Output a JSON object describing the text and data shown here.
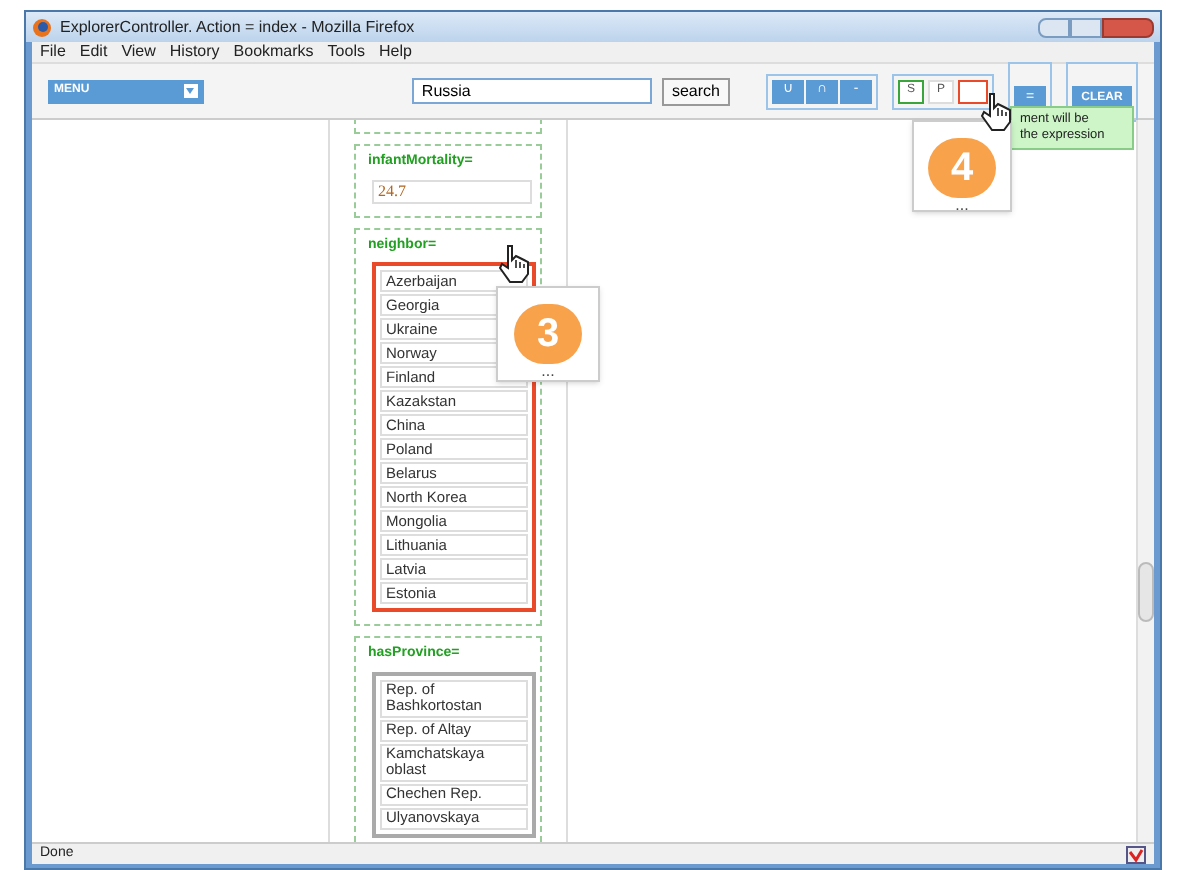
{
  "window": {
    "title": "ExplorerController. Action = index - Mozilla Firefox"
  },
  "menu_bar": [
    "File",
    "Edit",
    "View",
    "History",
    "Bookmarks",
    "Tools",
    "Help"
  ],
  "toolbar": {
    "menu_button": "MENU",
    "search_value": "Russia",
    "search_button": "search",
    "set_ops": [
      "∪",
      "∩",
      "-"
    ],
    "mode_buttons": [
      {
        "label": "S",
        "selected": true
      },
      {
        "label": "P",
        "selected": false
      }
    ],
    "drop_slot": {
      "highlighted": true
    },
    "equals_button": "=",
    "clear_button": "CLEAR"
  },
  "properties": [
    {
      "name": "infantMortality=",
      "kind": "value",
      "value": "24.7"
    },
    {
      "name": "neighbor=",
      "kind": "list",
      "highlighted": true,
      "items": [
        "Azerbaijan",
        "Georgia",
        "Ukraine",
        "Norway",
        "Finland",
        "Kazakstan",
        "China",
        "Poland",
        "Belarus",
        "North Korea",
        "Mongolia",
        "Lithuania",
        "Latvia",
        "Estonia"
      ]
    },
    {
      "name": "hasProvince=",
      "kind": "list",
      "highlighted": false,
      "items": [
        "Rep. of Bashkortostan",
        "Rep. of Altay",
        "Kamchatskaya oblast",
        "Chechen Rep.",
        "Ulyanovskaya"
      ]
    }
  ],
  "callouts": [
    {
      "number": "3",
      "more": "..."
    },
    {
      "number": "4",
      "more": "..."
    }
  ],
  "tooltip": {
    "lines": [
      "ment will be",
      "the expression"
    ]
  },
  "status_bar": "Done"
}
